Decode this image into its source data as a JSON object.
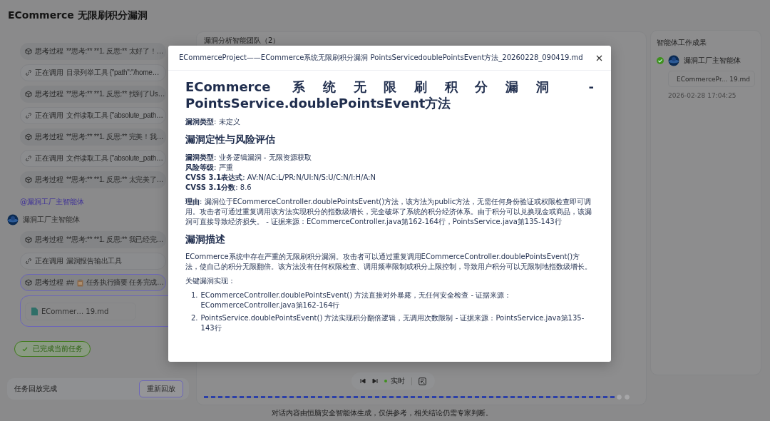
{
  "app_title": "ECommerce 无限刷积分漏洞",
  "log": {
    "items": [
      {
        "kind": "think",
        "label": "思考过程",
        "text": "**思考:** **1. 反思:** 太好了！…"
      },
      {
        "kind": "call",
        "label": "正在调用",
        "text": "目录列举工具 {\"path\":\"/home…"
      },
      {
        "kind": "think",
        "label": "思考过程",
        "text": "**思考:** **1. 反思:** 找到了Us…"
      },
      {
        "kind": "call",
        "label": "正在调用",
        "text": "文件读取工具 {\"absolute_path…"
      },
      {
        "kind": "think",
        "label": "思考过程",
        "text": "**思考:** **1. 反思:** 完美！我…"
      },
      {
        "kind": "call",
        "label": "正在调用",
        "text": "文件读取工具 {\"absolute_path…"
      },
      {
        "kind": "think",
        "label": "思考过程",
        "text": "**思考:** **1. 反思:** 太完美了…"
      }
    ],
    "mention": "@漏洞工厂主智能体",
    "agent": "漏洞工厂主智能体",
    "agent_items": [
      {
        "kind": "think",
        "label": "思考过程",
        "text": "**思考:** **1. 反思:** 我已经完…",
        "selected": false
      },
      {
        "kind": "call",
        "label": "正在调用",
        "text": "漏洞报告输出工具",
        "selected": false
      },
      {
        "kind": "summary",
        "label": "思考过程",
        "prefix": "##",
        "text": "任务执行摘要 任务完成…",
        "selected": true
      }
    ],
    "file": "ECommer… 19.md",
    "status_badge": "已完成当前任务",
    "replay": {
      "status": "任务回放完成",
      "button": "重新回放"
    }
  },
  "team_panel": {
    "title": "漏洞分析智能团队（2）",
    "live": true,
    "live_label": "实时",
    "progress": {
      "level": 1
    }
  },
  "results": {
    "title": "智能体工作成果",
    "agents": [
      {
        "name": "漏洞工厂主智能体",
        "done": true,
        "file": "ECommercePr... 19.md",
        "time": "2026-02-28 17:04:25"
      }
    ]
  },
  "modal": {
    "title": "ECommerceProject——ECommerce系统无限刷积分漏洞 PointsServicedoublePointsEvent方法_20260228_090419.md",
    "content": [
      {
        "kind": "h1",
        "text": "ECommerce 系统无限刷积分漏洞 - PointsService.doublePointsEvent方法"
      },
      {
        "kind": "p",
        "text": "**漏洞类型**: 未定义"
      },
      {
        "kind": "h2",
        "text": "漏洞定性与风险评估"
      },
      {
        "kind": "lines",
        "lines": [
          "**漏洞类型**: 业务逻辑漏洞 - 无限资源获取",
          "**风险等级**: 严重",
          "**CVSS 3.1表达式**: AV:N/AC:L/PR:N/UI:N/S:U/C:N/I:H/A:N",
          "**CVSS 3.1分数**: 8.6"
        ]
      },
      {
        "kind": "p",
        "text": "**理由**: 漏洞位于ECommerceController.doublePointsEvent()方法，该方法为public方法，无需任何身份验证或权限检查即可调用。攻击者可通过重复调用该方法实现积分的指数级增长，完全破坏了系统的积分经济体系。由于积分可以兑换现金或商品，该漏洞可直接导致经济损失。 - 证据来源：ECommerceController.java第162-164行，PointsService.java第135-143行"
      },
      {
        "kind": "h2",
        "text": "漏洞描述"
      },
      {
        "kind": "p",
        "text": "ECommerce系统中存在严重的无限刷积分漏洞。攻击者可以通过重复调用ECommerceController.doublePointsEvent()方法，使自己的积分无限翻倍。该方法没有任何权限检查、调用频率限制或积分上限控制，导致用户积分可以无限制地指数级增长。"
      },
      {
        "kind": "p",
        "text": "关键漏洞实现："
      },
      {
        "kind": "list",
        "items": [
          {
            "number": "1.",
            "text": "ECommerceController.doublePointsEvent() 方法直接对外暴露，无任何安全检查 - 证据来源：ECommerceController.java第162-164行"
          },
          {
            "number": "2.",
            "text": "PointsService.doublePointsEvent() 方法实现积分翻倍逻辑，无调用次数限制 - 证据来源：PointsService.java第135-143行"
          }
        ]
      }
    ]
  },
  "footer": "对话内容由恒脑安全智能体生成，仅供参考，相关结论仍需专家判断。"
}
